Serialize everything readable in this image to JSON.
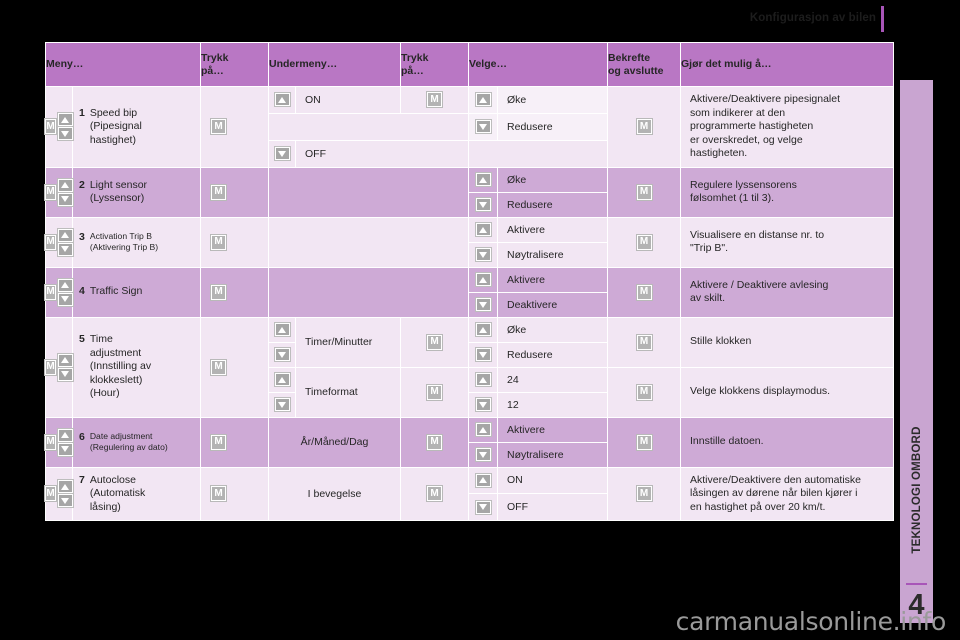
{
  "header": {
    "title": "Konfigurasjon av bilen"
  },
  "sidebar": {
    "label": "TEKNOLOGI OMBORD",
    "chapter": "4"
  },
  "watermark": "carmanualsonline.info",
  "icons": {
    "m": "M",
    "up": "up-arrow",
    "down": "down-arrow"
  },
  "table": {
    "columns": [
      "Meny…",
      "Trykk på…",
      "Undermeny…",
      "Trykk på…",
      "Velge…",
      "Bekrefte og avslutte",
      "Gjør det mulig å…"
    ],
    "col_press1_line1": "Trykk",
    "col_press1_line2": "på…",
    "col_press2_line1": "Trykk",
    "col_press2_line2": "på…",
    "col_confirm_line1": "Bekrefte",
    "col_confirm_line2": "og avslutte",
    "rows": [
      {
        "num": "1",
        "name": "Speed bip\n(Pipesignal\nhastighet)",
        "name_l1": "Speed bip",
        "name_l2": "(Pipesignal",
        "name_l3": "hastighet)",
        "submenu_on": "ON",
        "submenu_off": "OFF",
        "select_up": "Øke",
        "select_down": "Redusere",
        "desc": "Aktivere/Deaktivere pipesignalet som indikerer at den programmerte hastigheten er overskredet, og velge hastigheten.",
        "desc_l1": "Aktivere/Deaktivere pipesignalet",
        "desc_l2": "som indikerer at den",
        "desc_l3": "programmerte hastigheten",
        "desc_l4": "er overskredet, og velge",
        "desc_l5": "hastigheten."
      },
      {
        "num": "2",
        "name_l1": "Light sensor",
        "name_l2": "(Lyssensor)",
        "select_up": "Øke",
        "select_down": "Redusere",
        "desc_l1": "Regulere lyssensorens",
        "desc_l2": "følsomhet (1 til 3)."
      },
      {
        "num": "3",
        "name_l1": "Activation Trip B",
        "name_l2": "(Aktivering Trip B)",
        "select_up": "Aktivere",
        "select_down": "Nøytralisere",
        "desc_l1": "Visualisere en distanse nr. to",
        "desc_l2": "\"Trip B\"."
      },
      {
        "num": "4",
        "name_l1": "Traffic Sign",
        "select_up": "Aktivere",
        "select_down": "Deaktivere",
        "desc_l1": "Aktivere / Deaktivere avlesing",
        "desc_l2": "av skilt."
      },
      {
        "num": "5",
        "name_l1": "Time",
        "name_l2": "adjustment",
        "name_l3": "(Innstilling av",
        "name_l4": "klokkeslett)",
        "name_l5": "(Hour)",
        "sub_a": "Timer/Minutter",
        "sub_a_up": "Øke",
        "sub_a_down": "Redusere",
        "sub_a_desc": "Stille klokken",
        "sub_b": "Timeformat",
        "sub_b_up": "24",
        "sub_b_down": "12",
        "sub_b_desc": "Velge klokkens displaymodus."
      },
      {
        "num": "6",
        "name_l1": "Date adjustment",
        "name_l2": "(Regulering av dato)",
        "submenu": "År/Måned/Dag",
        "select_up": "Aktivere",
        "select_down": "Nøytralisere",
        "desc_l1": "Innstille datoen."
      },
      {
        "num": "7",
        "name_l1": "Autoclose",
        "name_l2": "(Automatisk",
        "name_l3": "låsing)",
        "submenu": "I bevegelse",
        "select_up": "ON",
        "select_down": "OFF",
        "desc_l1": "Aktivere/Deaktivere den automatiske",
        "desc_l2": "låsingen av dørene når bilen kjører i",
        "desc_l3": "en hastighet på over 20 km/t."
      }
    ]
  },
  "colors": {
    "header_bg": "#b977c4",
    "band_light": "#f2e6f3",
    "band_dark": "#ceaad6",
    "accent": "#a855b8",
    "sidebar_bg": "#c9a5d1"
  }
}
